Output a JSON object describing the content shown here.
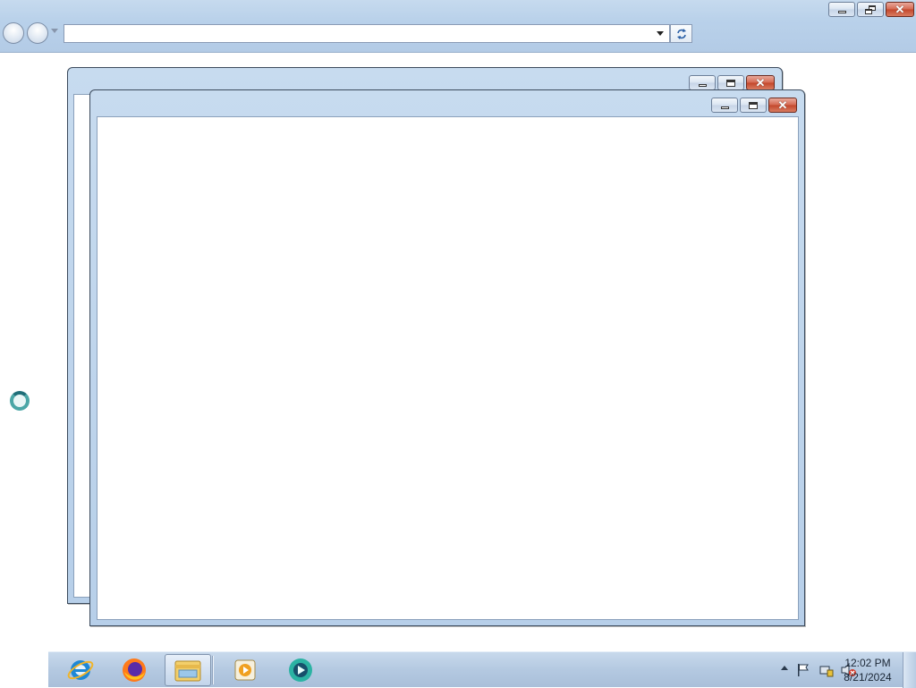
{
  "browser": {
    "address": {
      "value": "",
      "placeholder": ""
    },
    "caption_buttons": [
      "minimize-icon",
      "restore-icon",
      "close-icon"
    ]
  },
  "child_windows": [
    {
      "caption_buttons": [
        "minimize-icon",
        "maximize-icon",
        "close-icon"
      ]
    },
    {
      "caption_buttons": [
        "minimize-icon",
        "maximize-icon",
        "close-icon"
      ]
    }
  ],
  "taskbar": {
    "pinned": [
      {
        "name": "internet-explorer-icon",
        "active": false
      },
      {
        "name": "firefox-icon",
        "active": false
      },
      {
        "name": "file-explorer-icon",
        "active": true
      },
      {
        "name": "media-player-icon",
        "active": false
      },
      {
        "name": "app-icon",
        "active": false
      }
    ],
    "tray_icons": [
      "show-hidden-icons-chevron",
      "action-center-flag-icon",
      "network-icon",
      "volume-muted-icon"
    ],
    "clock": {
      "time": "12:02 PM",
      "date": "8/21/2024"
    }
  },
  "colors": {
    "window_frame": "#b9d1ea",
    "close_button": "#c2462b",
    "taskbar": "#b4c9e1"
  }
}
